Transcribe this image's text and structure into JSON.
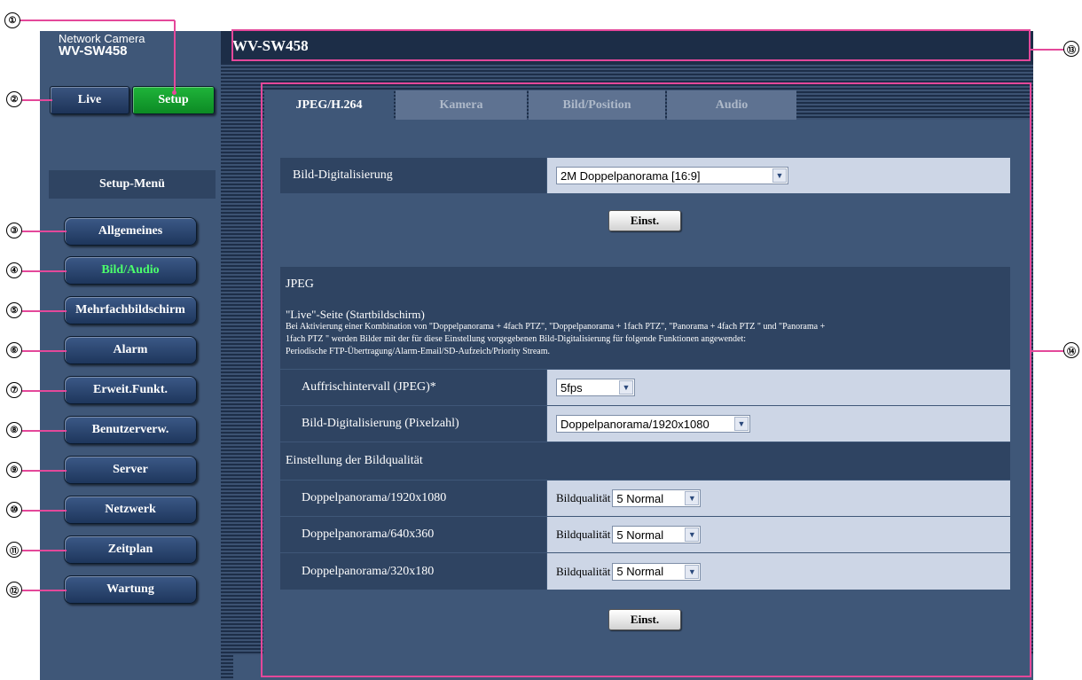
{
  "header": {
    "brand_small": "Network Camera",
    "brand_model": "WV-SW458",
    "title": "WV-SW458"
  },
  "mode_buttons": {
    "live": "Live",
    "setup": "Setup"
  },
  "setup_menu": {
    "title": "Setup-Menü",
    "items": [
      {
        "label": "Allgemeines",
        "active": false
      },
      {
        "label": "Bild/Audio",
        "active": true
      },
      {
        "label": "Mehrfachbildschirm",
        "active": false
      },
      {
        "label": "Alarm",
        "active": false
      },
      {
        "label": "Erweit.Funkt.",
        "active": false
      },
      {
        "label": "Benutzerverw.",
        "active": false
      },
      {
        "label": "Server",
        "active": false
      },
      {
        "label": "Netzwerk",
        "active": false
      },
      {
        "label": "Zeitplan",
        "active": false
      },
      {
        "label": "Wartung",
        "active": false
      }
    ]
  },
  "tabs": [
    "JPEG/H.264",
    "Kamera",
    "Bild/Position",
    "Audio"
  ],
  "active_tab": 0,
  "capture": {
    "label": "Bild-Digitalisierung",
    "value": "2M Doppelpanorama [16:9]",
    "button": "Einst."
  },
  "jpeg": {
    "header": "JPEG",
    "note_title": "\"Live\"-Seite (Startbildschirm)",
    "note_line1": "Bei Aktivierung einer Kombination von \"Doppelpanorama + 4fach PTZ\", \"Doppelpanorama + 1fach PTZ\", \"Panorama + 4fach PTZ \" und \"Panorama +",
    "note_line2": "1fach PTZ \" werden Bilder mit der für diese Einstellung vorgegebenen Bild-Digitalisierung für folgende Funktionen angewendet:",
    "note_line3": "Periodische FTP-Übertragung/Alarm-Email/SD-Aufzeich/Priority Stream.",
    "refresh_label": "Auffrischintervall (JPEG)*",
    "refresh_value": "5fps",
    "pixel_label": "Bild-Digitalisierung (Pixelzahl)",
    "pixel_value": "Doppelpanorama/1920x1080",
    "quality_header": "Einstellung der Bildqualität",
    "quality_rows": [
      {
        "label": "Doppelpanorama/1920x1080",
        "prefix": "Bildqualität",
        "value": "5 Normal"
      },
      {
        "label": "Doppelpanorama/640x360",
        "prefix": "Bildqualität",
        "value": "5 Normal"
      },
      {
        "label": "Doppelpanorama/320x180",
        "prefix": "Bildqualität",
        "value": "5 Normal"
      }
    ],
    "button": "Einst."
  },
  "callouts": [
    "①",
    "②",
    "③",
    "④",
    "⑤",
    "⑥",
    "⑦",
    "⑧",
    "⑨",
    "⑩",
    "⑪",
    "⑫",
    "⑬",
    "⑭"
  ],
  "colors": {
    "panel_bg": "#3f5778",
    "dark_bar": "#2f4462",
    "value_bg": "#cdd6e6",
    "setup_green": "#1fb43a",
    "active_menu_text": "#4bff6c",
    "callout_pink": "#e4489a"
  }
}
